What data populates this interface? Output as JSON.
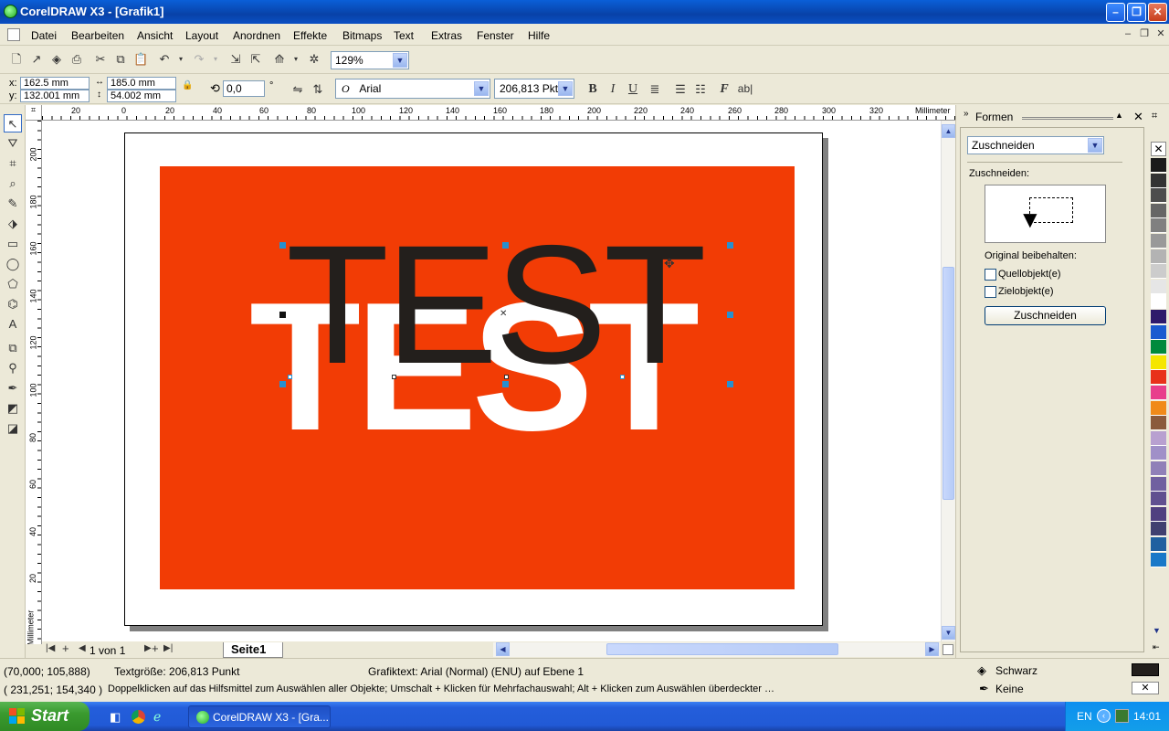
{
  "window": {
    "title": "CorelDRAW X3 - [Grafik1]"
  },
  "menu": [
    "Datei",
    "Bearbeiten",
    "Ansicht",
    "Layout",
    "Anordnen",
    "Effekte",
    "Bitmaps",
    "Text",
    "Extras",
    "Fenster",
    "Hilfe"
  ],
  "toolbar": {
    "zoom": "129%"
  },
  "propbar": {
    "x_label": "x:",
    "x": "162.5 mm",
    "y_label": "y:",
    "y": "132.001 mm",
    "w": "185.0 mm",
    "h": "54.002 mm",
    "rotation": "0,0",
    "rotation_unit": "°",
    "font": "Arial",
    "font_size": "206,813 Pkt",
    "bold": "B",
    "italic": "I",
    "underline": "U"
  },
  "ruler": {
    "unit": "Millimeter",
    "h_labels": [
      "20",
      "0",
      "20",
      "40",
      "60",
      "80",
      "100",
      "120",
      "140",
      "160",
      "180",
      "200",
      "220",
      "240",
      "260",
      "280",
      "300",
      "320"
    ],
    "v_labels": [
      "200",
      "180",
      "160",
      "140",
      "120",
      "100",
      "80",
      "60",
      "40",
      "20"
    ]
  },
  "canvas": {
    "text_front": "TEST",
    "text_back": "TEST",
    "background_color": "#f23c05"
  },
  "pagenav": {
    "count": "1 von 1",
    "tab": "Seite1"
  },
  "docker": {
    "title": "Formen",
    "mode": "Zuschneiden",
    "section_label": "Zuschneiden:",
    "keep_label": "Original beibehalten:",
    "source_label": "Quellobjekt(e)",
    "target_label": "Zielobjekt(e)",
    "apply_button": "Zuschneiden"
  },
  "palette": [
    "#1a1a1a",
    "#333333",
    "#4d4d4d",
    "#666666",
    "#808080",
    "#999999",
    "#b3b3b3",
    "#cccccc",
    "#e6e6e6",
    "#ffffff",
    "#2e1a6b",
    "#1a5bd0",
    "#008a3c",
    "#f5e600",
    "#e8311a",
    "#e83e8c",
    "#f08a1a",
    "#8b5a3c",
    "#b8a0d0",
    "#a090c8",
    "#9080b8",
    "#7060a0",
    "#605090",
    "#504080",
    "#404070",
    "#2060a0",
    "#1878c8"
  ],
  "status": {
    "coords1": "(70,000; 105,888)",
    "textsize": "Textgröße: 206,813 Punkt",
    "object_info": "Grafiktext: Arial (Normal) (ENU) auf Ebene 1",
    "coords2": "( 231,251; 154,340 )",
    "hint": "Doppelklicken auf das Hilfsmittel zum Auswählen aller Objekte; Umschalt + Klicken für Mehrfachauswahl; Alt + Klicken zum Auswählen überdeckter …",
    "fill_label": "Schwarz",
    "outline_label": "Keine"
  },
  "taskbar": {
    "start": "Start",
    "task": "CorelDRAW X3 - [Gra...",
    "lang": "EN",
    "time": "14:01"
  }
}
